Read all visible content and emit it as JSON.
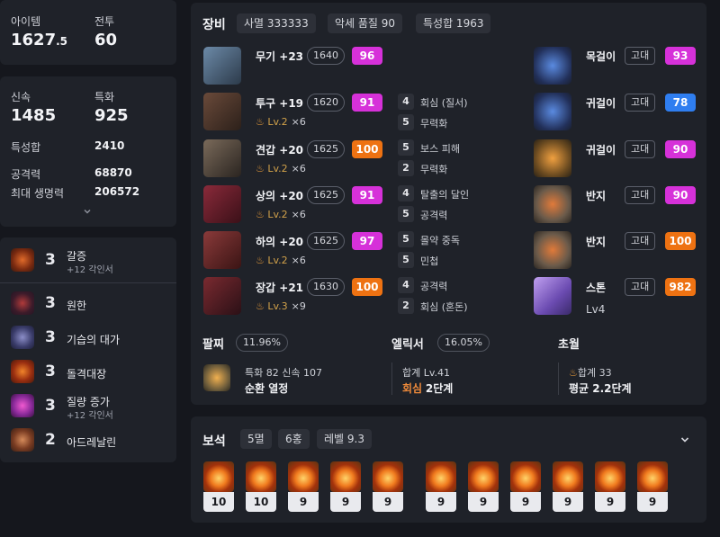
{
  "stats_top": {
    "item_label": "아이템",
    "item_value": "1627",
    "item_decimal": ".5",
    "combat_label": "전투",
    "combat_value": "60"
  },
  "stats_mid": {
    "crit_label": "신속",
    "crit_value": "1485",
    "spec_label": "특화",
    "spec_value": "925",
    "total_label": "특성합",
    "total_value": "2410",
    "atk_label": "공격력",
    "atk_value": "68870",
    "hp_label": "최대 생명력",
    "hp_value": "206572"
  },
  "engravings": [
    {
      "level": "3",
      "name": "갈증",
      "sub": "+12 각인서"
    },
    {
      "level": "3",
      "name": "원한",
      "sub": ""
    },
    {
      "level": "3",
      "name": "기습의 대가",
      "sub": ""
    },
    {
      "level": "3",
      "name": "돌격대장",
      "sub": ""
    },
    {
      "level": "3",
      "name": "질량 증가",
      "sub": "+12 각인서"
    },
    {
      "level": "2",
      "name": "아드레날린",
      "sub": ""
    }
  ],
  "equipment": {
    "title": "장비",
    "chips": [
      "사멸 333333",
      "악세 품질 90",
      "특성합 1963"
    ],
    "gear": [
      {
        "name": "무기 +23",
        "ilvl": "1640",
        "quality": "96",
        "sub": "",
        "cnt": ""
      },
      {
        "name": "투구 +19",
        "ilvl": "1620",
        "quality": "91",
        "sub": "Lv.2",
        "cnt": "×6"
      },
      {
        "name": "견갑 +20",
        "ilvl": "1625",
        "quality": "100",
        "sub": "Lv.2",
        "cnt": "×6"
      },
      {
        "name": "상의 +20",
        "ilvl": "1625",
        "quality": "91",
        "sub": "Lv.2",
        "cnt": "×6"
      },
      {
        "name": "하의 +20",
        "ilvl": "1625",
        "quality": "97",
        "sub": "Lv.2",
        "cnt": "×6"
      },
      {
        "name": "장갑 +21",
        "ilvl": "1630",
        "quality": "100",
        "sub": "Lv.3",
        "cnt": "×9"
      }
    ],
    "effects": [
      {
        "num": "4",
        "text": "회심 (질서)"
      },
      {
        "num": "5",
        "text": "무력화"
      },
      {
        "num": "5",
        "text": "보스 피해"
      },
      {
        "num": "2",
        "text": "무력화"
      },
      {
        "num": "4",
        "text": "탈출의 달인"
      },
      {
        "num": "5",
        "text": "공격력"
      },
      {
        "num": "5",
        "text": "몰약 중독"
      },
      {
        "num": "5",
        "text": "민첩"
      },
      {
        "num": "4",
        "text": "공격력"
      },
      {
        "num": "2",
        "text": "회심 (혼돈)"
      }
    ],
    "accessories": [
      {
        "name": "목걸이",
        "grade": "고대",
        "quality": "93"
      },
      {
        "name": "귀걸이",
        "grade": "고대",
        "quality": "78"
      },
      {
        "name": "귀걸이",
        "grade": "고대",
        "quality": "90"
      },
      {
        "name": "반지",
        "grade": "고대",
        "quality": "90"
      },
      {
        "name": "반지",
        "grade": "고대",
        "quality": "100"
      },
      {
        "name": "스톤",
        "grade": "고대",
        "quality": "982",
        "extra": "Lv4"
      }
    ]
  },
  "bracelet": {
    "title": "팔찌",
    "pct": "11.96%",
    "line1": "특화 82  신속 107",
    "line2": "순환  열정"
  },
  "elixir": {
    "title": "엘릭서",
    "pct": "16.05%",
    "line1": "합계 Lv.41",
    "line2a": "회심",
    "line2b": "2단계"
  },
  "transcend": {
    "title": "초월",
    "line1": "합계 33",
    "line2": "평균 2.2단계"
  },
  "gems": {
    "title": "보석",
    "chips": [
      "5멸",
      "6홍",
      "레벨 9.3"
    ],
    "levels": [
      "10",
      "10",
      "9",
      "9",
      "9",
      "9",
      "9",
      "9",
      "9",
      "9",
      "9"
    ]
  },
  "colors": {
    "magenta": "#d631d9",
    "orange": "#ee7212",
    "blue": "#2f7ef0"
  }
}
